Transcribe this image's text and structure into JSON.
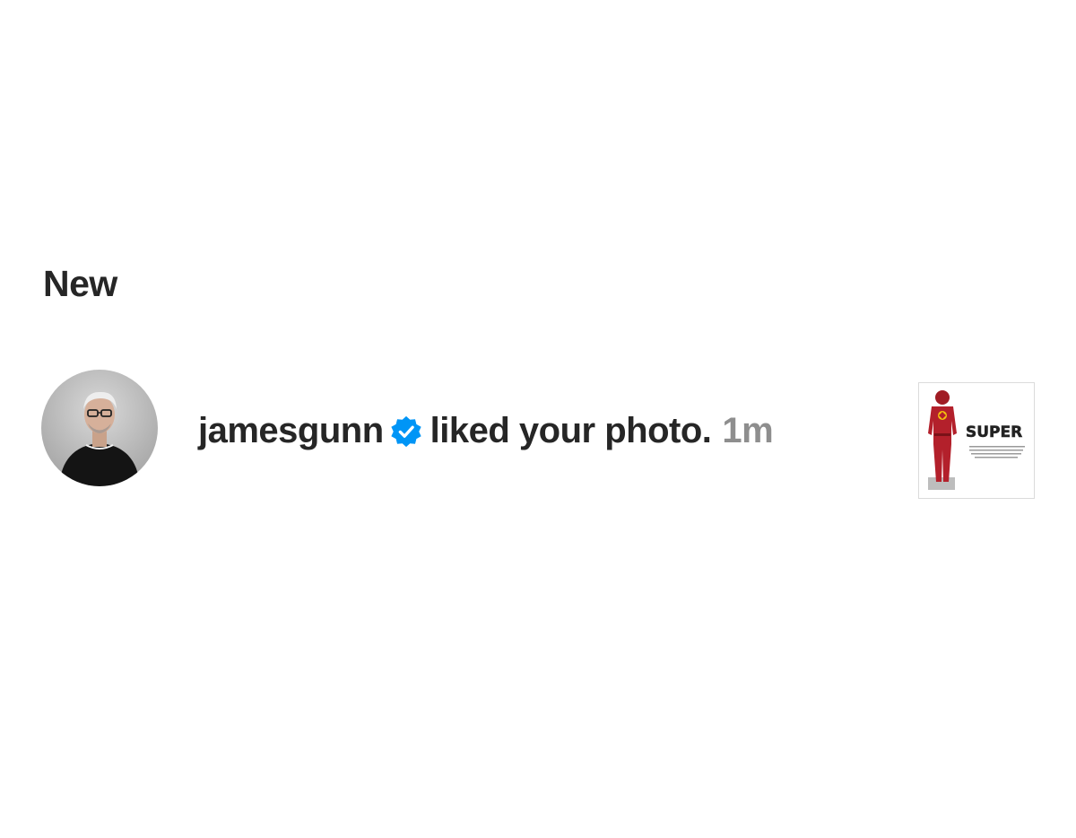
{
  "section": {
    "title": "New"
  },
  "notification": {
    "username": "jamesgunn",
    "verified": true,
    "action": "liked your photo.",
    "time": "1m",
    "post_thumbnail": {
      "logo_text": "SUPER"
    }
  },
  "colors": {
    "text_primary": "#262626",
    "text_secondary": "#8e8e8e",
    "verified_badge": "#0095f6",
    "background": "#ffffff"
  },
  "icons": {
    "verified": "verified-badge-icon"
  }
}
